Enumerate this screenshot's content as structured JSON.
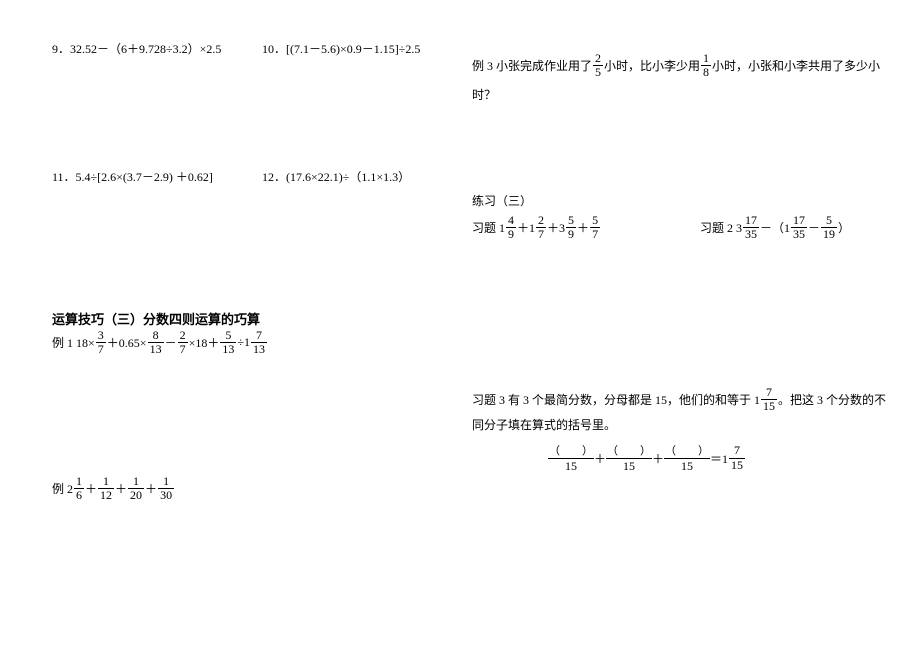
{
  "left": {
    "p9": "9．32.52－（6＋9.728÷3.2）×2.5",
    "p10": "10．[(7.1－5.6)×0.9－1.15]÷2.5",
    "p11": "11．5.4÷[2.6×(3.7－2.9) ＋0.62]",
    "p12": "12．(17.6×22.1)÷（1.1×1.3）",
    "section_title": "运算技巧（三）分数四则运算的巧算",
    "ex1_label": "例 1   18×",
    "ex1_f1_n": "3",
    "ex1_f1_d": "7",
    "ex1_op1": "＋0.65×",
    "ex1_f2_n": "8",
    "ex1_f2_d": "13",
    "ex1_op2": "－",
    "ex1_f3_n": "2",
    "ex1_f3_d": "7",
    "ex1_op3": "×18＋",
    "ex1_f4_n": "5",
    "ex1_f4_d": "13",
    "ex1_op4": "÷1",
    "ex1_f5_n": "7",
    "ex1_f5_d": "13",
    "ex2_label": "例 2   ",
    "ex2_f1_n": "1",
    "ex2_f1_d": "6",
    "ex2_op1": "＋",
    "ex2_f2_n": "1",
    "ex2_f2_d": "12",
    "ex2_op2": "＋",
    "ex2_f3_n": "1",
    "ex2_f3_d": "20",
    "ex2_op3": "＋",
    "ex2_f4_n": "1",
    "ex2_f4_d": "30"
  },
  "right": {
    "ex3_a": "例 3    小张完成作业用了",
    "ex3_f1_n": "2",
    "ex3_f1_d": "5",
    "ex3_b": "小时，比小李少用",
    "ex3_f2_n": "1",
    "ex3_f2_d": "8",
    "ex3_c": "小时，小张和小李共用了多少小",
    "ex3_d": "时？",
    "practice_title": "练习（三）",
    "q1_label": "习题 1    ",
    "q1_f1_n": "4",
    "q1_f1_d": "9",
    "q1_op1": "＋1",
    "q1_f2_n": "2",
    "q1_f2_d": "7",
    "q1_op2": "＋3",
    "q1_f3_n": "5",
    "q1_f3_d": "9",
    "q1_op3": "＋",
    "q1_f4_n": "5",
    "q1_f4_d": "7",
    "q2_label": "习题 2    3",
    "q2_f1_n": "17",
    "q2_f1_d": "35",
    "q2_op1": "－（1",
    "q2_f2_n": "17",
    "q2_f2_d": "35",
    "q2_op2": "－",
    "q2_f3_n": "5",
    "q2_f3_d": "19",
    "q2_op3": "）",
    "q3_a": "习题 3    有 3 个最简分数，分母都是 15，他们的和等于 1",
    "q3_f1_n": "7",
    "q3_f1_d": "15",
    "q3_b": "。把这 3 个分数的不",
    "q3_c": "同分子填在算式的括号里。",
    "blank_num": "（        ）",
    "blank_den": "15",
    "q3_plus": "＋",
    "q3_eq": "＝1",
    "q3_rf_n": "7",
    "q3_rf_d": "15"
  }
}
